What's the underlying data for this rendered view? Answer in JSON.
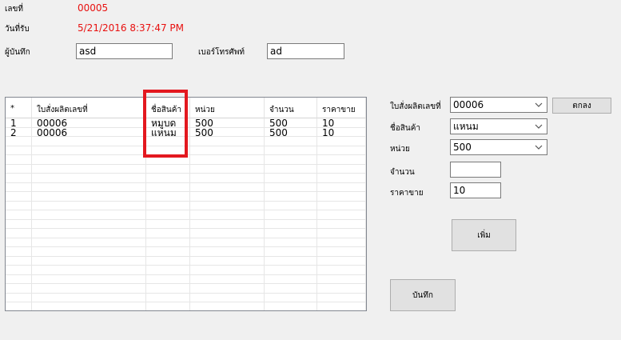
{
  "header": {
    "number_label": "เลขที่",
    "number_value": "00005",
    "date_label": "วันที่รับ",
    "date_value": "5/21/2016 8:37:47 PM",
    "recorder_label": "ผู้บันทึก",
    "recorder_value": "asd",
    "phone_label": "เบอร์โทรศัพท์",
    "phone_value": "ad"
  },
  "grid": {
    "columns": [
      "*",
      "ใบสั่งผลิตเลขที่",
      "ชื่อสินค้า",
      "หน่วย",
      "จำนวน",
      "ราคาขาย"
    ],
    "rows": [
      [
        "1",
        "00006",
        "หมูบด",
        "500",
        "500",
        "10"
      ],
      [
        "2",
        "00006",
        "แหนม",
        "500",
        "500",
        "10"
      ]
    ]
  },
  "form": {
    "order_label": "ใบสั่งผลิตเลขที่",
    "order_value": "00006",
    "ok_button": "ตกลง",
    "product_label": "ชื่อสินค้า",
    "product_value": "แหนม",
    "unit_label": "หน่วย",
    "unit_value": "500",
    "qty_label": "จำนวน",
    "qty_value": "",
    "price_label": "ราคาขาย",
    "price_value": "10",
    "add_button": "เพิ่ม",
    "save_button": "บันทึก"
  },
  "icons": {
    "dropdown": "chevron-down-icon"
  },
  "colors": {
    "highlight_value": "#e8100f",
    "annotation_box": "#e3181f"
  }
}
